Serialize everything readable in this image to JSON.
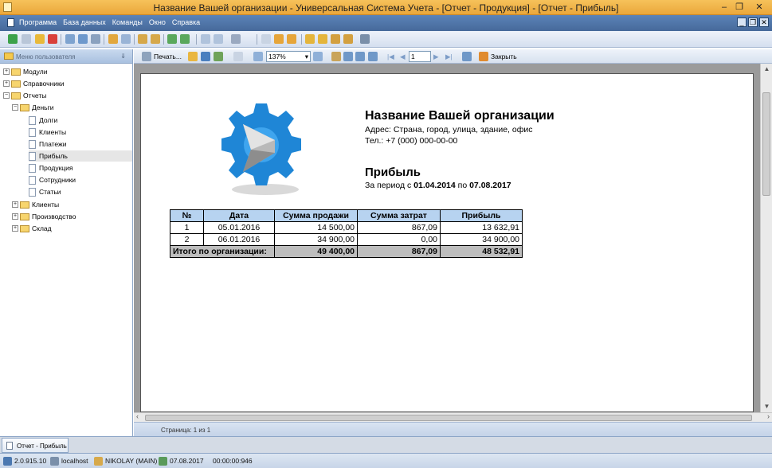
{
  "window": {
    "title": "Название Вашей организации - Универсальная Система Учета - [Отчет - Продукция] - [Отчет - Прибыль]",
    "minimize": "–",
    "restore": "❐",
    "close": "✕"
  },
  "menu": {
    "items": [
      "Программа",
      "База данных",
      "Команды",
      "Окно",
      "Справка"
    ],
    "mdi": [
      "_",
      "❐",
      "✕"
    ]
  },
  "sidebar": {
    "header": "Меню пользователя",
    "pin": "⇓",
    "tree": [
      {
        "label": "Модули",
        "expander": "+"
      },
      {
        "label": "Справочники",
        "expander": "+"
      },
      {
        "label": "Отчеты",
        "expander": "−"
      },
      {
        "label": "Деньги",
        "expander": "−"
      },
      {
        "label": "Долги"
      },
      {
        "label": "Клиенты"
      },
      {
        "label": "Платежи"
      },
      {
        "label": "Прибыль"
      },
      {
        "label": "Продукция"
      },
      {
        "label": "Сотрудники"
      },
      {
        "label": "Статьи"
      },
      {
        "label": "Клиенты",
        "expander": "+"
      },
      {
        "label": "Производство",
        "expander": "+"
      },
      {
        "label": "Склад",
        "expander": "+"
      }
    ]
  },
  "preview_toolbar": {
    "print": "Печать...",
    "zoom": "137%",
    "page_input": "1",
    "close": "Закрыть",
    "dropdown_arrow": "▾",
    "nav": [
      "|◀",
      "◀",
      "▶",
      "▶|"
    ]
  },
  "report": {
    "org_name": "Название Вашей организации",
    "address": "Адрес: Страна, город, улица, здание, офис",
    "phone": "Тел.: +7 (000) 000-00-00",
    "title": "Прибыль",
    "period_prefix": "За период с",
    "period_from": "01.04.2014",
    "period_mid": "по",
    "period_to": "07.08.2017",
    "columns": [
      "№",
      "Дата",
      "Сумма продажи",
      "Сумма затрат",
      "Прибыль"
    ],
    "rows": [
      [
        "1",
        "05.01.2016",
        "14 500,00",
        "867,09",
        "13 632,91"
      ],
      [
        "2",
        "06.01.2016",
        "34 900,00",
        "0,00",
        "34 900,00"
      ]
    ],
    "total": {
      "label": "Итого по организации:",
      "sales": "49 400,00",
      "costs": "867,09",
      "profit": "48 532,91"
    }
  },
  "preview_status": "Страница: 1 из 1",
  "taskbar": {
    "tab": "Отчет - Прибыль"
  },
  "statusbar": {
    "version": "2.0.915.10",
    "server": "localhost",
    "user": "NIKOLAY (MAIN)",
    "date": "07.08.2017",
    "time": "00:00:00:946"
  },
  "colors": {
    "titlebar": "#eaa73b",
    "menubar": "#46699a",
    "table_header": "#b7d3f0",
    "total_row": "#bdbdbd"
  }
}
